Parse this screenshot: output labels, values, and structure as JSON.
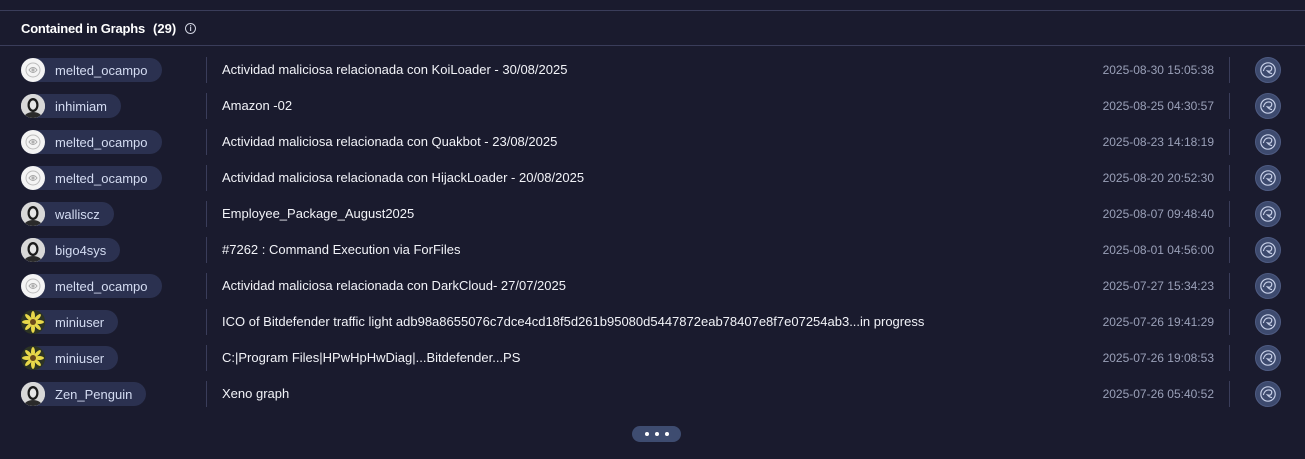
{
  "header": {
    "title": "Contained in Graphs",
    "count": "(29)",
    "info_icon": "info-icon"
  },
  "rows": [
    {
      "user": "melted_ocampo",
      "avatar": "logo",
      "graph": "Actividad maliciosa relacionada con KoiLoader - 30/08/2025",
      "date": "2025-08-30 15:05:38"
    },
    {
      "user": "inhimiam",
      "avatar": "person",
      "graph": "Amazon -02",
      "date": "2025-08-25 04:30:57"
    },
    {
      "user": "melted_ocampo",
      "avatar": "logo",
      "graph": "Actividad maliciosa relacionada con Quakbot - 23/08/2025",
      "date": "2025-08-23 14:18:19"
    },
    {
      "user": "melted_ocampo",
      "avatar": "logo",
      "graph": "Actividad maliciosa relacionada con HijackLoader - 20/08/2025",
      "date": "2025-08-20 20:52:30"
    },
    {
      "user": "walliscz",
      "avatar": "person",
      "graph": "Employee_Package_August2025",
      "date": "2025-08-07 09:48:40"
    },
    {
      "user": "bigo4sys",
      "avatar": "person",
      "graph": "#7262 : Command Execution via ForFiles",
      "date": "2025-08-01 04:56:00"
    },
    {
      "user": "melted_ocampo",
      "avatar": "logo",
      "graph": "Actividad maliciosa relacionada con DarkCloud- 27/07/2025",
      "date": "2025-07-27 15:34:23"
    },
    {
      "user": "miniuser",
      "avatar": "flower",
      "graph": "ICO of Bitdefender traffic light adb98a8655076c7dce4cd18f5d261b95080d5447872eab78407e8f7e07254ab3...in progress",
      "date": "2025-07-26 19:41:29"
    },
    {
      "user": "miniuser",
      "avatar": "flower",
      "graph": "C:|Program Files|HPwHpHwDiag|...Bitdefender...PS",
      "date": "2025-07-26 19:08:53"
    },
    {
      "user": "Zen_Penguin",
      "avatar": "person",
      "graph": "Xeno graph",
      "date": "2025-07-26 05:40:52"
    }
  ],
  "more_button_icon": "more-dots-icon",
  "colors": {
    "background": "#1a1b2e",
    "chip": "#2b3150",
    "graph_button": "#3d4a6e",
    "divider": "#3a3d5a"
  }
}
